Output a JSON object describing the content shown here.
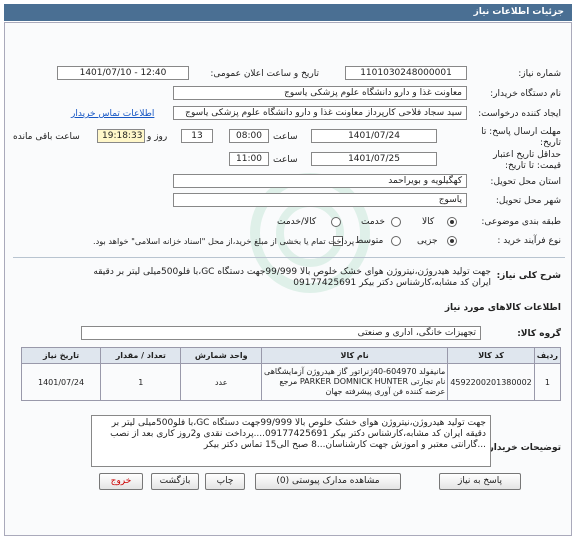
{
  "title": "جزئیات اطلاعات نیاز",
  "need_number": {
    "label": "شماره نیاز:",
    "value": "1101030248000001"
  },
  "announce": {
    "label": "تاریخ و ساعت اعلان عمومی:",
    "value": "1401/07/10 - 12:40"
  },
  "device_name": {
    "label": "نام دستگاه خریدار:",
    "value": "معاونت غذا و دارو دانشگاه علوم پزشکی یاسوج"
  },
  "requester": {
    "label": "ایجاد کننده درخواست:",
    "value": "سید سجاد فلاحی کارپرداز معاونت غذا و دارو دانشگاه علوم پزشکی یاسوج",
    "contact_link": "اطلاعات تماس خریدار"
  },
  "deadline_send": {
    "label1": "مهلت ارسال پاسخ: تا",
    "label2": "تاریخ:",
    "date": "1401/07/24",
    "time_label": "ساعت",
    "time": "08:00",
    "days": "13",
    "days_label": "روز و",
    "remaining": "19:18:33",
    "remaining_label": "ساعت باقی مانده"
  },
  "validity": {
    "label1": "حداقل تاریخ اعتبار",
    "label2": "قیمت: تا تاریخ:",
    "date": "1401/07/25",
    "time_label": "ساعت",
    "time": "11:00"
  },
  "province": {
    "label": "استان محل تحویل:",
    "value": "کهگیلویه و بویراحمد"
  },
  "city": {
    "label": "شهر محل تحویل:",
    "value": "یاسوج"
  },
  "category": {
    "label": "طبقه بندی موضوعی:",
    "options": [
      "کالا",
      "خدمت",
      "کالا/خدمت"
    ],
    "selected": 0
  },
  "process": {
    "label": "نوع فرآیند خرید :",
    "options": [
      "جزیی",
      "متوسط"
    ],
    "selected": 0,
    "payment_note": "پرداخت تمام یا بخشی از مبلغ خرید،از محل \"اسناد خزانه اسلامی\" خواهد بود."
  },
  "summary": {
    "label": "شرح کلی نیاز:",
    "text": "جهت تولید هیدروژن،نیتروژن هوای خشک خلوص بالا 99/999جهت دستگاه GC،با فلو500میلی لیتر بر دقیقه ایران کد مشابه،کارشناس دکتر بیکر 09177425691"
  },
  "goods_title": "اطلاعات کالاهای مورد نیاز",
  "group": {
    "label": "گروه کالا:",
    "value": "تجهیزات خانگی، اداری و صنعتی"
  },
  "table": {
    "headers": [
      "ردیف",
      "کد کالا",
      "نام کالا",
      "واحد شمارش",
      "تعداد / مقدار",
      "تاریخ نیاز"
    ],
    "rows": [
      {
        "row": "1",
        "code": "4592200201380002",
        "name": "مانیفولد 604970-40ژنراتور گاز هیدروژن آزمایشگاهی نام تجارتی PARKER DOMNICK HUNTER مرجع عرضه کننده فن آوری پیشرفته جهان",
        "unit": "عدد",
        "qty": "1",
        "date": "1401/07/24"
      }
    ]
  },
  "buyer_notes": {
    "label": "توضیحات خریدار:",
    "text": "جهت تولید هیدروژن،نیتروژن هوای خشک خلوص بالا 99/999جهت دستگاه GC،با فلو500میلی لیتر بر دقیقه ایران کد مشابه،کارشناس دکتر بیکر 09177425691....پرداخت نقدی و2روز کاری بعد از نصب ...گارانتی معتبر و اموزش جهت کارشناسان...8 صبح الی15 تماس دکتر بیکر"
  },
  "buttons": {
    "reply": "پاسخ به نیاز",
    "attachments": "مشاهده مدارک پیوستی (0)",
    "print": "چاپ",
    "back": "بازگشت",
    "exit": "خروج"
  },
  "colors": {
    "titlebar": "#4a6f93",
    "link": "#1556c4",
    "highlight": "#fff7c9"
  }
}
